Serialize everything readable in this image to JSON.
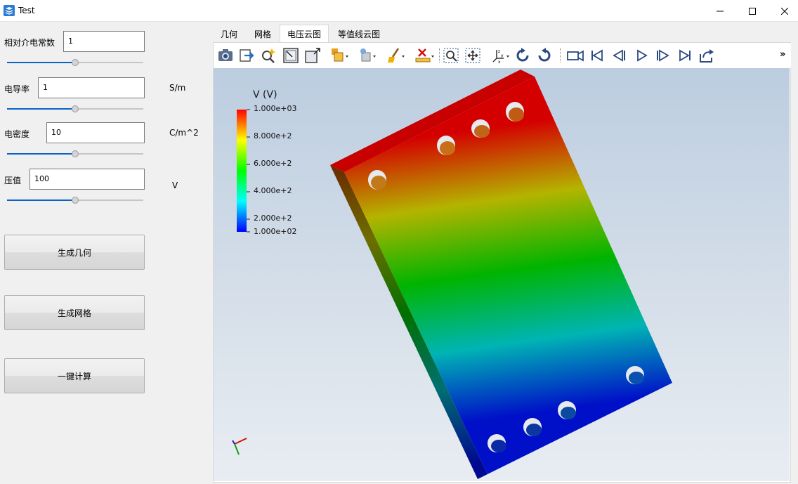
{
  "window": {
    "title": "Test"
  },
  "params": [
    {
      "label": "相对介电常数",
      "value": "1",
      "unit": "",
      "slider_fraction": 0.5
    },
    {
      "label": "电导率",
      "value": "1",
      "unit": "S/m",
      "slider_fraction": 0.5
    },
    {
      "label": "电密度",
      "value": "10",
      "unit": "C/m^2",
      "slider_fraction": 0.5
    },
    {
      "label": "压值",
      "value": "100",
      "unit": "V",
      "slider_fraction": 0.5
    }
  ],
  "buttons": {
    "geometry": "生成几何",
    "mesh": "生成网格",
    "compute": "一键计算"
  },
  "tabs": [
    {
      "label": "几何",
      "active": false
    },
    {
      "label": "网格",
      "active": false
    },
    {
      "label": "电压云图",
      "active": true
    },
    {
      "label": "等值线云图",
      "active": false
    }
  ],
  "toolbar": {
    "icons": [
      "screenshot-icon",
      "export-icon",
      "query-icon",
      "view-fit-icon",
      "view-box-icon",
      "display-mode-icon",
      "pick-icon",
      "clear-icon",
      "delete-icon",
      "zoom-box-icon",
      "pan-icon",
      "axes-icon",
      "rotate-ccw-icon",
      "rotate-cw-icon",
      "camera-icon",
      "first-frame-icon",
      "prev-frame-icon",
      "play-icon",
      "next-frame-icon",
      "last-frame-icon",
      "share-icon"
    ],
    "overflow": "»"
  },
  "legend": {
    "title": "V (V)",
    "max_label": "1.000e+03",
    "ticks": [
      "8.000e+2",
      "6.000e+2",
      "4.000e+2",
      "2.000e+2"
    ],
    "min_label": "1.000e+02",
    "colors": [
      "#ff0000",
      "#ffff00",
      "#00ff00",
      "#00ffff",
      "#0000ff"
    ]
  },
  "colormap": {
    "top": "#d40000",
    "upper": "#b4b400",
    "middle": "#00b400",
    "lower": "#00b4b4",
    "bottom": "#0010c8"
  }
}
